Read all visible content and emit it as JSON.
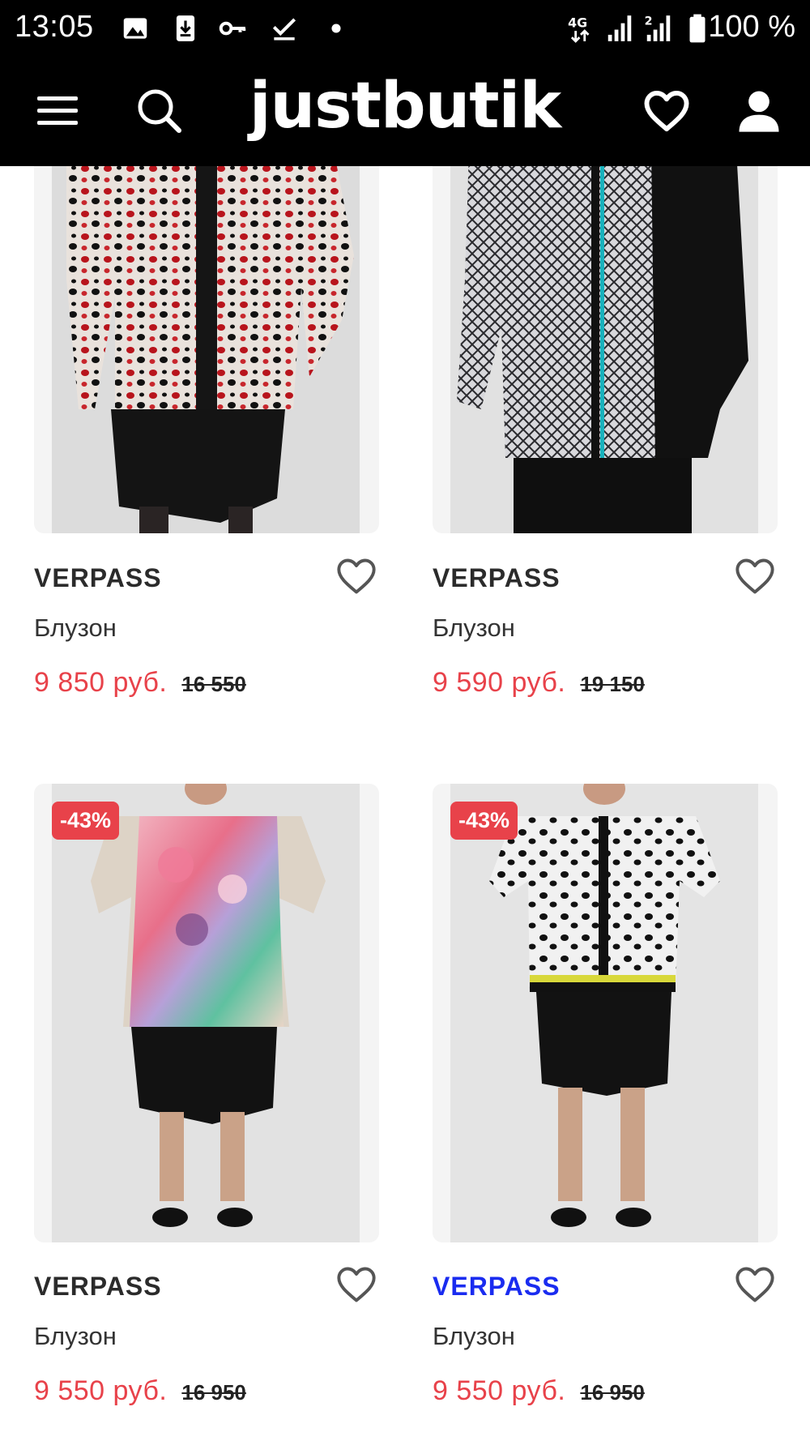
{
  "status_bar": {
    "time": "13:05",
    "battery": "100 %",
    "icons": [
      "image-icon",
      "download-icon",
      "key-icon",
      "check-icon",
      "dot-icon",
      "4g-icon",
      "signal-icon",
      "signal-2-icon",
      "battery-icon"
    ]
  },
  "header": {
    "logo": "justbutik",
    "icons": [
      "menu-icon",
      "search-icon",
      "heart-icon",
      "user-icon"
    ]
  },
  "products": [
    {
      "brand": "VERPASS",
      "name": "Блузон",
      "price": "9 850 руб.",
      "old_price": "16 550",
      "badge": ""
    },
    {
      "brand": "VERPASS",
      "name": "Блузон",
      "price": "9 590 руб.",
      "old_price": "19 150",
      "badge": ""
    },
    {
      "brand": "VERPASS",
      "name": "Блузон",
      "price": "9 550 руб.",
      "old_price": "16 950",
      "badge": "-43%"
    },
    {
      "brand": "VERPASS",
      "name": "Блузон",
      "price": "9 550 руб.",
      "old_price": "16 950",
      "badge": "-43%"
    }
  ],
  "colors": {
    "accent_red": "#e8424a",
    "header_bg": "#000000",
    "highlight_blue": "#1a2cf0"
  }
}
